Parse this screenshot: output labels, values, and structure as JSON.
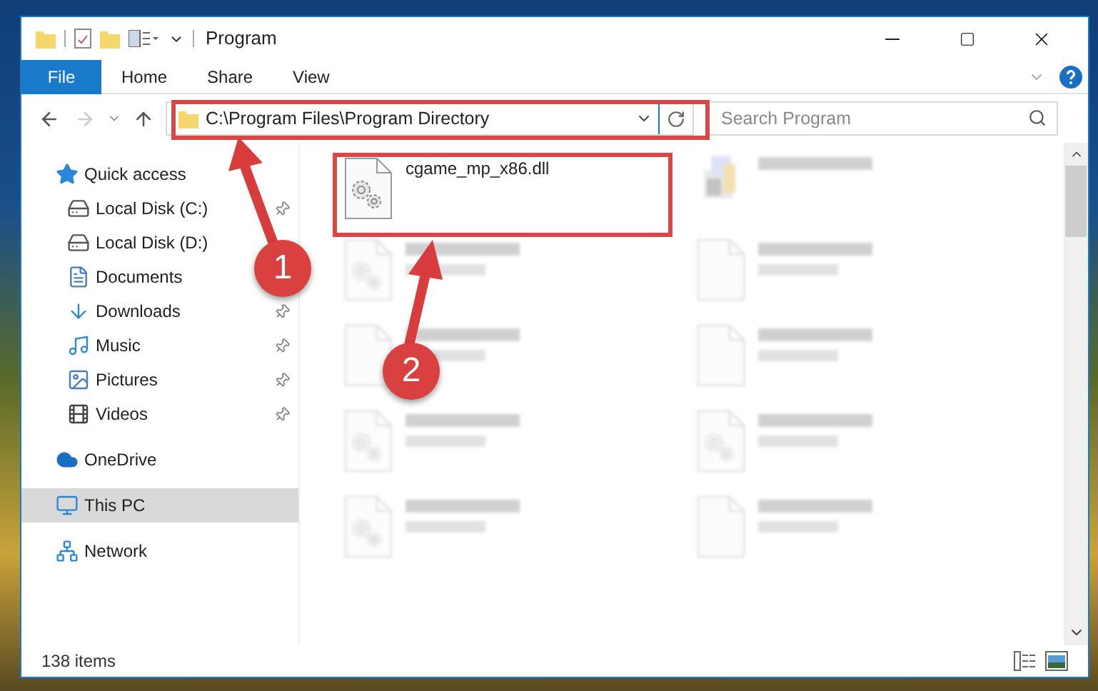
{
  "window": {
    "title": "Program"
  },
  "ribbon": {
    "file_button": "File",
    "tabs": [
      "Home",
      "Share",
      "View"
    ]
  },
  "address": {
    "path": "C:\\Program Files\\Program Directory"
  },
  "search": {
    "placeholder": "Search Program"
  },
  "sidebar": {
    "items": [
      {
        "label": "Quick access",
        "kind": "star",
        "selected": false,
        "children": [
          {
            "label": "Local Disk (C:)",
            "kind": "drive",
            "pinned": true,
            "selected": false
          },
          {
            "label": "Local Disk (D:)",
            "kind": "drive",
            "selected": false
          },
          {
            "label": "Documents",
            "kind": "document",
            "selected": false
          },
          {
            "label": "Downloads",
            "kind": "download",
            "pinned": true,
            "selected": false
          },
          {
            "label": "Music",
            "kind": "music",
            "pinned": true,
            "selected": false
          },
          {
            "label": "Pictures",
            "kind": "pictures",
            "pinned": true,
            "selected": false
          },
          {
            "label": "Videos",
            "kind": "videos",
            "pinned": true,
            "selected": false
          }
        ]
      },
      {
        "label": "OneDrive",
        "kind": "cloud",
        "selected": false
      },
      {
        "label": "This PC",
        "kind": "pc",
        "selected": true
      },
      {
        "label": "Network",
        "kind": "network",
        "selected": false
      }
    ]
  },
  "files": [
    {
      "name": "cgame_mp_x86.dll",
      "kind": "dll",
      "blurred": false,
      "highlighted": true
    },
    {
      "kind": "exe",
      "blurred": true
    },
    {
      "kind": "dll",
      "blurred": true
    },
    {
      "kind": "blank",
      "blurred": true
    },
    {
      "kind": "blank",
      "blurred": true
    },
    {
      "kind": "blank",
      "blurred": true
    },
    {
      "kind": "dll",
      "blurred": true
    },
    {
      "kind": "dll",
      "blurred": true
    },
    {
      "kind": "dll",
      "blurred": true
    },
    {
      "kind": "blank",
      "blurred": true
    }
  ],
  "status_bar": {
    "count": "138 items"
  },
  "annotations": [
    {
      "number": "1"
    },
    {
      "number": "2"
    }
  ]
}
